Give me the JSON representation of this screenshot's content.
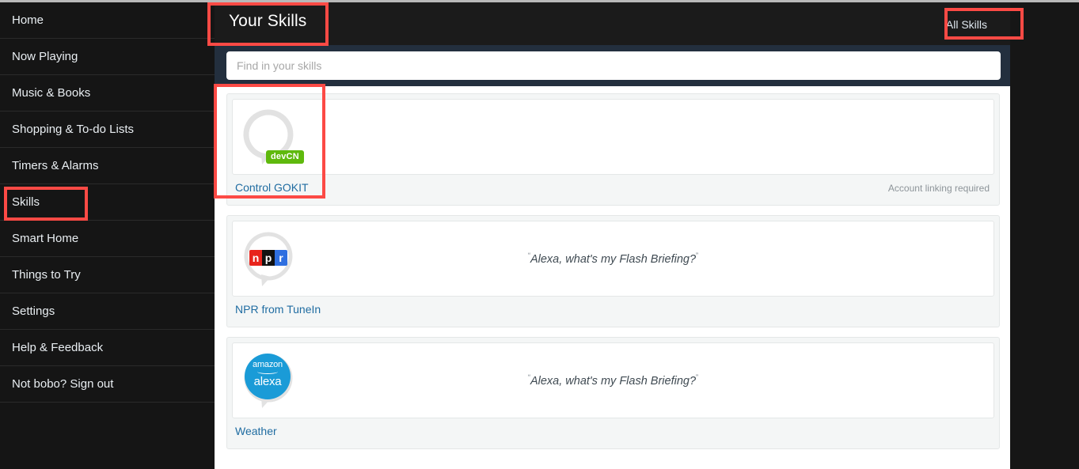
{
  "sidebar": {
    "items": [
      {
        "label": "Home"
      },
      {
        "label": "Now Playing"
      },
      {
        "label": "Music & Books"
      },
      {
        "label": "Shopping & To-do Lists"
      },
      {
        "label": "Timers & Alarms"
      },
      {
        "label": "Skills"
      },
      {
        "label": "Smart Home"
      },
      {
        "label": "Things to Try"
      },
      {
        "label": "Settings"
      },
      {
        "label": "Help & Feedback"
      },
      {
        "label": "Not bobo? Sign out"
      }
    ]
  },
  "header": {
    "title": "Your Skills",
    "all_skills_label": "All Skills"
  },
  "search": {
    "value": "",
    "placeholder": "Find in your skills"
  },
  "skills": [
    {
      "name": "Control GOKIT",
      "badge": "devCN",
      "phrase": "",
      "meta": "Account linking required",
      "icon": "speech-bubble-placeholder-icon"
    },
    {
      "name": "NPR from TuneIn",
      "badge": "",
      "phrase": "Alexa, what's my Flash Briefing?",
      "meta": "",
      "icon": "npr-logo-icon"
    },
    {
      "name": "Weather",
      "badge": "",
      "phrase": "Alexa, what's my Flash Briefing?",
      "meta": "",
      "icon": "amazon-alexa-logo-icon"
    }
  ],
  "npr_logo": {
    "letters": [
      "n",
      "p",
      "r"
    ]
  },
  "alexa_logo": {
    "top_word": "amazon",
    "bottom_word": "alexa"
  },
  "quote_marks": {
    "open": "“",
    "close": "”"
  },
  "colors": {
    "sidebar_bg": "#151515",
    "topbar_bg": "#1b1b1b",
    "search_band_bg": "#232f3e",
    "link_blue": "#1f6ca1",
    "badge_green": "#5fb90d",
    "annotation_red": "#fc4a45",
    "npr_red": "#e8241c",
    "npr_black": "#111111",
    "npr_blue": "#2f6fe0",
    "alexa_blue": "#1a9bd7"
  }
}
